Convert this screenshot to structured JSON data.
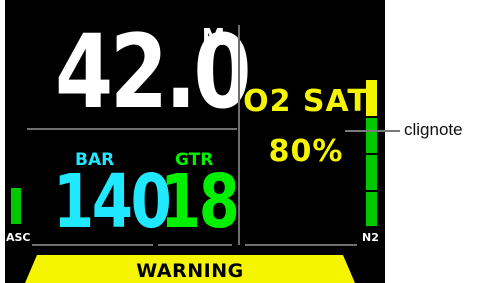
{
  "screen": {
    "depth": {
      "value": "42.0",
      "unit": "M"
    },
    "bar": {
      "label": "BAR",
      "value": "140"
    },
    "gtr": {
      "label": "GTR",
      "value": "18"
    },
    "o2_sat": {
      "label": "O2 SAT",
      "value": "80%",
      "fraction": 0.8
    },
    "asc_label": "ASC",
    "n2_label": "N2",
    "warning": "WARNING"
  },
  "annotation": {
    "callout": "clignote"
  },
  "colors": {
    "background": "#000000",
    "white_text": "#ffffff",
    "bar_text": "#20e8ff",
    "gtr_text": "#00f000",
    "o2_text": "#f5f500",
    "gauge_green": "#00c800",
    "gauge_yellow": "#f5f500",
    "warning_bg": "#f5f500",
    "divider": "#6f6f6f"
  }
}
